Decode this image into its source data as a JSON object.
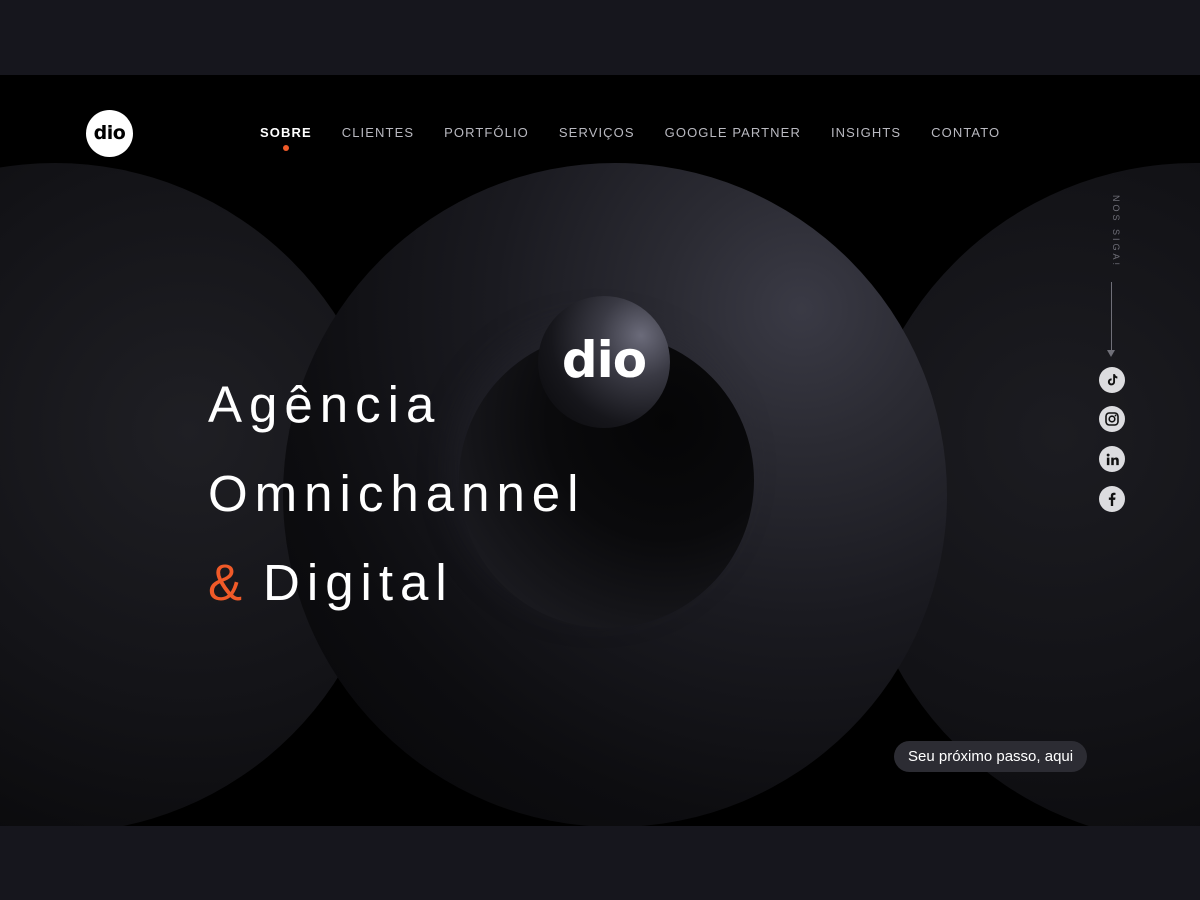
{
  "brand": {
    "logo_text": "dio"
  },
  "nav": {
    "items": [
      {
        "label": "SOBRE",
        "active": true
      },
      {
        "label": "CLIENTES",
        "active": false
      },
      {
        "label": "PORTFÓLIO",
        "active": false
      },
      {
        "label": "SERVIÇOS",
        "active": false
      },
      {
        "label": "GOOGLE PARTNER",
        "active": false
      },
      {
        "label": "INSIGHTS",
        "active": false
      },
      {
        "label": "CONTATO",
        "active": false
      }
    ]
  },
  "hero": {
    "logo_text": "dio",
    "line1": "Agência",
    "line2": "Omnichannel",
    "line3_amp": "&",
    "line3_rest": "Digital"
  },
  "social": {
    "label": "NOS SIGA!",
    "icons": [
      "tiktok-icon",
      "instagram-icon",
      "linkedin-icon",
      "facebook-icon"
    ]
  },
  "cta": {
    "label": "Seu próximo passo, aqui"
  },
  "colors": {
    "accent": "#f05a28",
    "background": "#000000",
    "outer": "#16161d"
  }
}
